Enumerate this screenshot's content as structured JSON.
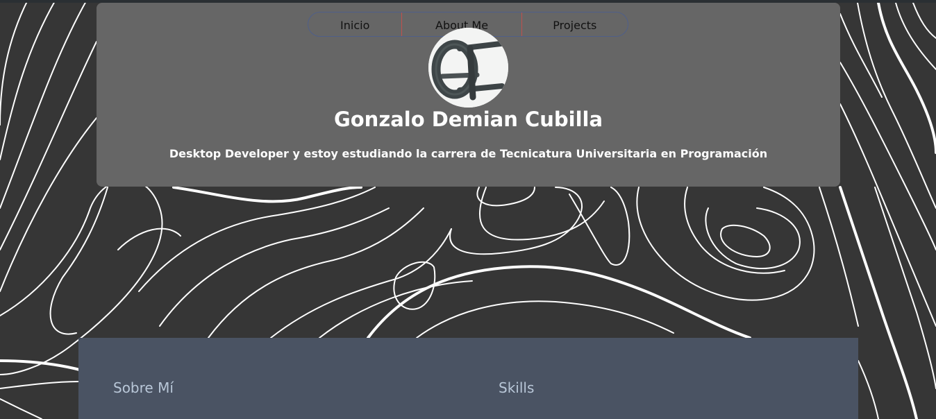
{
  "nav": {
    "items": [
      {
        "label": "Inicio"
      },
      {
        "label": "About Me"
      },
      {
        "label": "Projects"
      }
    ]
  },
  "hero": {
    "name": "Gonzalo Demian Cubilla",
    "tagline": "Desktop Developer y estoy estudiando la carrera de Tecnicatura Universitaria en Programación"
  },
  "sections": {
    "about_title": "Sobre Mí",
    "skills_title": "Skills"
  },
  "colors": {
    "background": "#363636",
    "hero_panel": "#666666",
    "section_panel": "#4a5363",
    "section_title": "#b9c7d8",
    "nav_border": "#4f5f8a",
    "nav_divider": "#c0504d"
  }
}
